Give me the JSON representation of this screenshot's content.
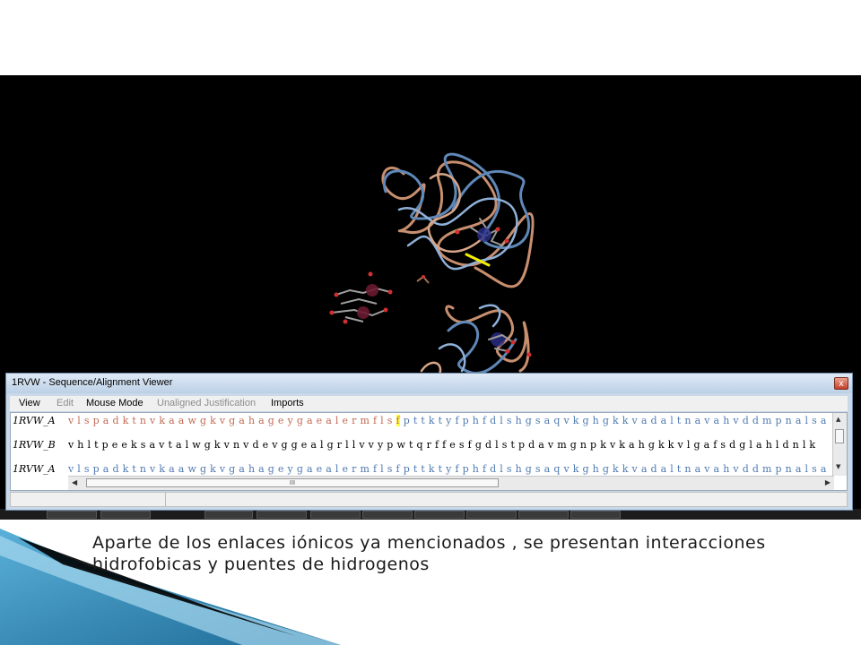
{
  "window": {
    "title": "1RVW - Sequence/Alignment Viewer",
    "close_glyph": "x"
  },
  "menu": [
    {
      "label": "View",
      "enabled": true
    },
    {
      "label": "Edit",
      "enabled": false
    },
    {
      "label": "Mouse Mode",
      "enabled": true
    },
    {
      "label": "Unaligned Justification",
      "enabled": false
    },
    {
      "label": "Imports",
      "enabled": true
    }
  ],
  "sequences": [
    {
      "label": "1RVW_A",
      "pre": "v l s p a d k t n v k a a w g k v g a h a g e y g a e a l e r m f l s ",
      "hl": "f",
      "post": " p t t k t y f p h f d l s h g s a q v k g h g k k v a d a l t n a v a h v d d m p n a l s a"
    },
    {
      "label": "1RVW_B",
      "pre": "v h l t p e e k s a v t a l w g k v n v d e v g g e a l g r l l v v y p w t q r f f e s f g d l s t p d a v m g n p k v k a h g k k v l g a f s d g l a h l d n l k",
      "hl": "",
      "post": ""
    },
    {
      "label": "1RVW_A",
      "pre": "v l s p a d k t n v k a a w g k v g a h a g e y g a e a l e r m f l s f p t t k t y f p h f d l s h g s a q v k g h g k k v a d a l t n a v a h v d d m p n a l s a",
      "hl": "",
      "post": ""
    }
  ],
  "scroll": {
    "hscroll_grip": "III",
    "left_arrow": "◀",
    "right_arrow": "▶",
    "up_arrow": "▲",
    "down_arrow": "▼"
  },
  "colors": {
    "highlight": "#ffff30",
    "sequence_text": "#7a8fc0",
    "viewer_bg": "#000000"
  },
  "caption": "Aparte de los enlaces iónicos ya mencionados , se presentan interacciones hidrofobicas  y puentes de hidrogenos"
}
